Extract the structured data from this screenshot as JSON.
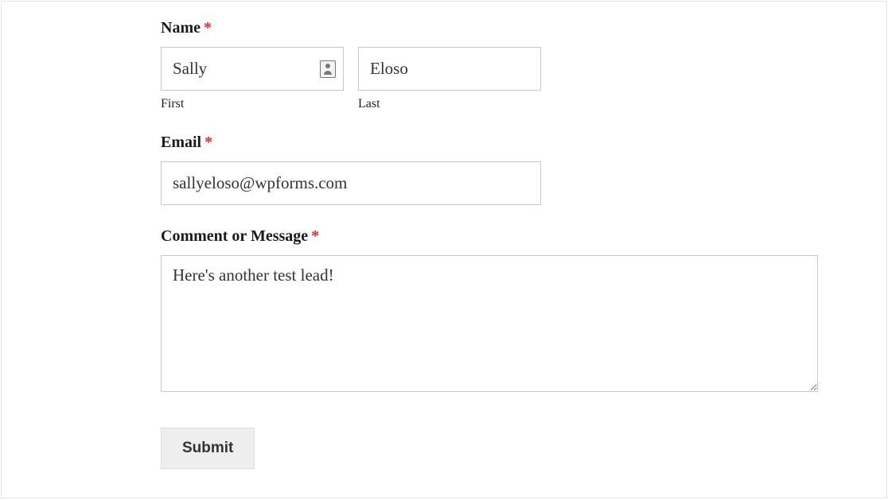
{
  "form": {
    "name": {
      "label": "Name",
      "required": "*",
      "first": {
        "value": "Sally",
        "sublabel": "First"
      },
      "last": {
        "value": "Eloso",
        "sublabel": "Last"
      }
    },
    "email": {
      "label": "Email",
      "required": "*",
      "value": "sallyeloso@wpforms.com"
    },
    "message": {
      "label": "Comment or Message",
      "required": "*",
      "value": "Here's another test lead!"
    },
    "submit": {
      "label": "Submit"
    }
  }
}
